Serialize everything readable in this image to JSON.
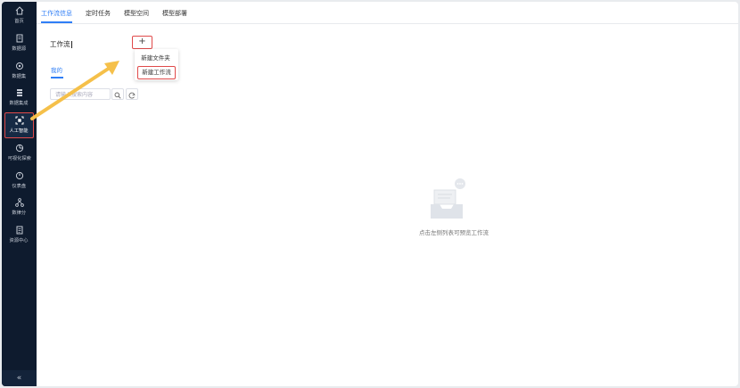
{
  "sidebar": {
    "items": [
      {
        "label": "首页",
        "icon": "home-icon"
      },
      {
        "label": "数据源",
        "icon": "database-icon"
      },
      {
        "label": "数据集",
        "icon": "dataset-icon"
      },
      {
        "label": "数据集成",
        "icon": "integration-icon"
      },
      {
        "label": "人工智能",
        "icon": "ai-icon"
      },
      {
        "label": "可视化探索",
        "icon": "chart-explore-icon"
      },
      {
        "label": "仪表盘",
        "icon": "dashboard-icon"
      },
      {
        "label": "数律分",
        "icon": "hierarchy-icon"
      },
      {
        "label": "资源中心",
        "icon": "resource-icon"
      }
    ],
    "active": "人工智能",
    "collapse_symbol": "«"
  },
  "tabs": [
    {
      "label": "工作流信息",
      "active": true
    },
    {
      "label": "定时任务",
      "active": false
    },
    {
      "label": "模型空间",
      "active": false
    },
    {
      "label": "模型部署",
      "active": false
    }
  ],
  "workflow": {
    "title": "工作流",
    "add_symbol": "+",
    "menu": [
      "新建文件夹",
      "新建工作流"
    ]
  },
  "subtab": "我的",
  "search": {
    "placeholder": "请输入搜索内容"
  },
  "empty": {
    "text": "点击左侧列表可预览工作流"
  },
  "colors": {
    "accent": "#2f7ef6",
    "sidebar": "#0e1b2e",
    "highlight": "#e04a4a",
    "arrow": "#f5c04a"
  }
}
